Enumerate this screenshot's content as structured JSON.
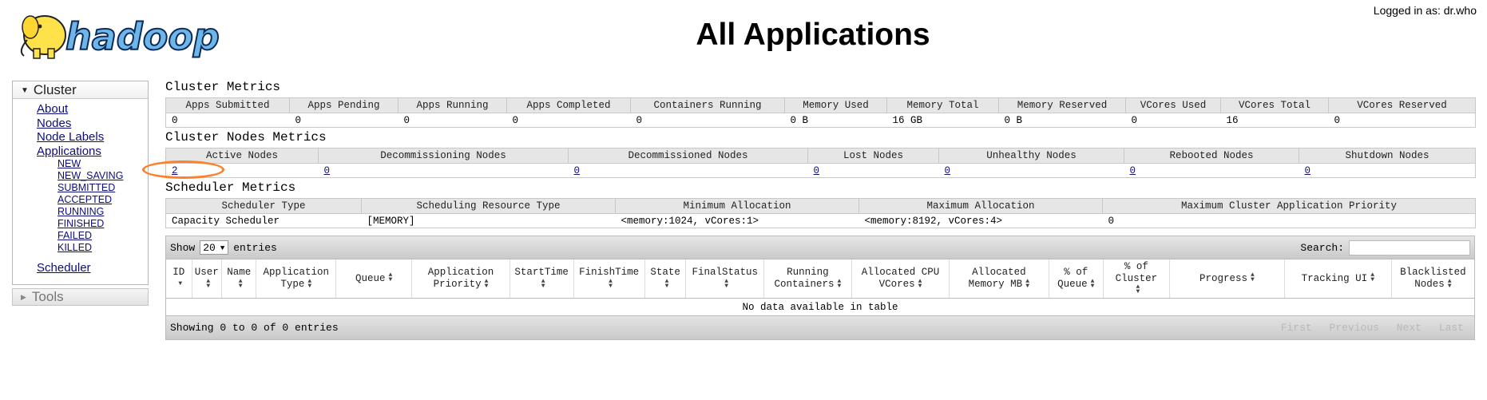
{
  "header": {
    "logo_text": "hadoop",
    "logged_in": "Logged in as: dr.who",
    "title": "All Applications"
  },
  "sidebar": {
    "cluster_label": "Cluster",
    "links": [
      "About",
      "Nodes",
      "Node Labels",
      "Applications"
    ],
    "app_states": [
      "NEW",
      "NEW_SAVING",
      "SUBMITTED",
      "ACCEPTED",
      "RUNNING",
      "FINISHED",
      "FAILED",
      "KILLED"
    ],
    "scheduler": "Scheduler",
    "tools_label": "Tools"
  },
  "cluster_metrics": {
    "title": "Cluster Metrics",
    "headers": [
      "Apps Submitted",
      "Apps Pending",
      "Apps Running",
      "Apps Completed",
      "Containers Running",
      "Memory Used",
      "Memory Total",
      "Memory Reserved",
      "VCores Used",
      "VCores Total",
      "VCores Reserved"
    ],
    "values": [
      "0",
      "0",
      "0",
      "0",
      "0",
      "0 B",
      "16 GB",
      "0 B",
      "0",
      "16",
      "0"
    ]
  },
  "node_metrics": {
    "title": "Cluster Nodes Metrics",
    "headers": [
      "Active Nodes",
      "Decommissioning Nodes",
      "Decommissioned Nodes",
      "Lost Nodes",
      "Unhealthy Nodes",
      "Rebooted Nodes",
      "Shutdown Nodes"
    ],
    "values": [
      "2",
      "0",
      "0",
      "0",
      "0",
      "0",
      "0"
    ]
  },
  "scheduler_metrics": {
    "title": "Scheduler Metrics",
    "headers": [
      "Scheduler Type",
      "Scheduling Resource Type",
      "Minimum Allocation",
      "Maximum Allocation",
      "Maximum Cluster Application Priority"
    ],
    "values": [
      "Capacity Scheduler",
      "[MEMORY]",
      "<memory:1024, vCores:1>",
      "<memory:8192, vCores:4>",
      "0"
    ]
  },
  "apps_table": {
    "show_label": "Show",
    "entries_value": "20",
    "entries_label": "entries",
    "search_label": "Search:",
    "search_value": "",
    "columns": [
      "ID",
      "User",
      "Name",
      "Application Type",
      "Queue",
      "Application Priority",
      "StartTime",
      "FinishTime",
      "State",
      "FinalStatus",
      "Running Containers",
      "Allocated CPU VCores",
      "Allocated Memory MB",
      "% of Queue",
      "% of Cluster",
      "Progress",
      "Tracking UI",
      "Blacklisted Nodes"
    ],
    "empty_text": "No data available in table",
    "info": "Showing 0 to 0 of 0 entries",
    "pager": [
      "First",
      "Previous",
      "Next",
      "Last"
    ]
  },
  "annotation": {
    "color": "#ff7f2a"
  }
}
